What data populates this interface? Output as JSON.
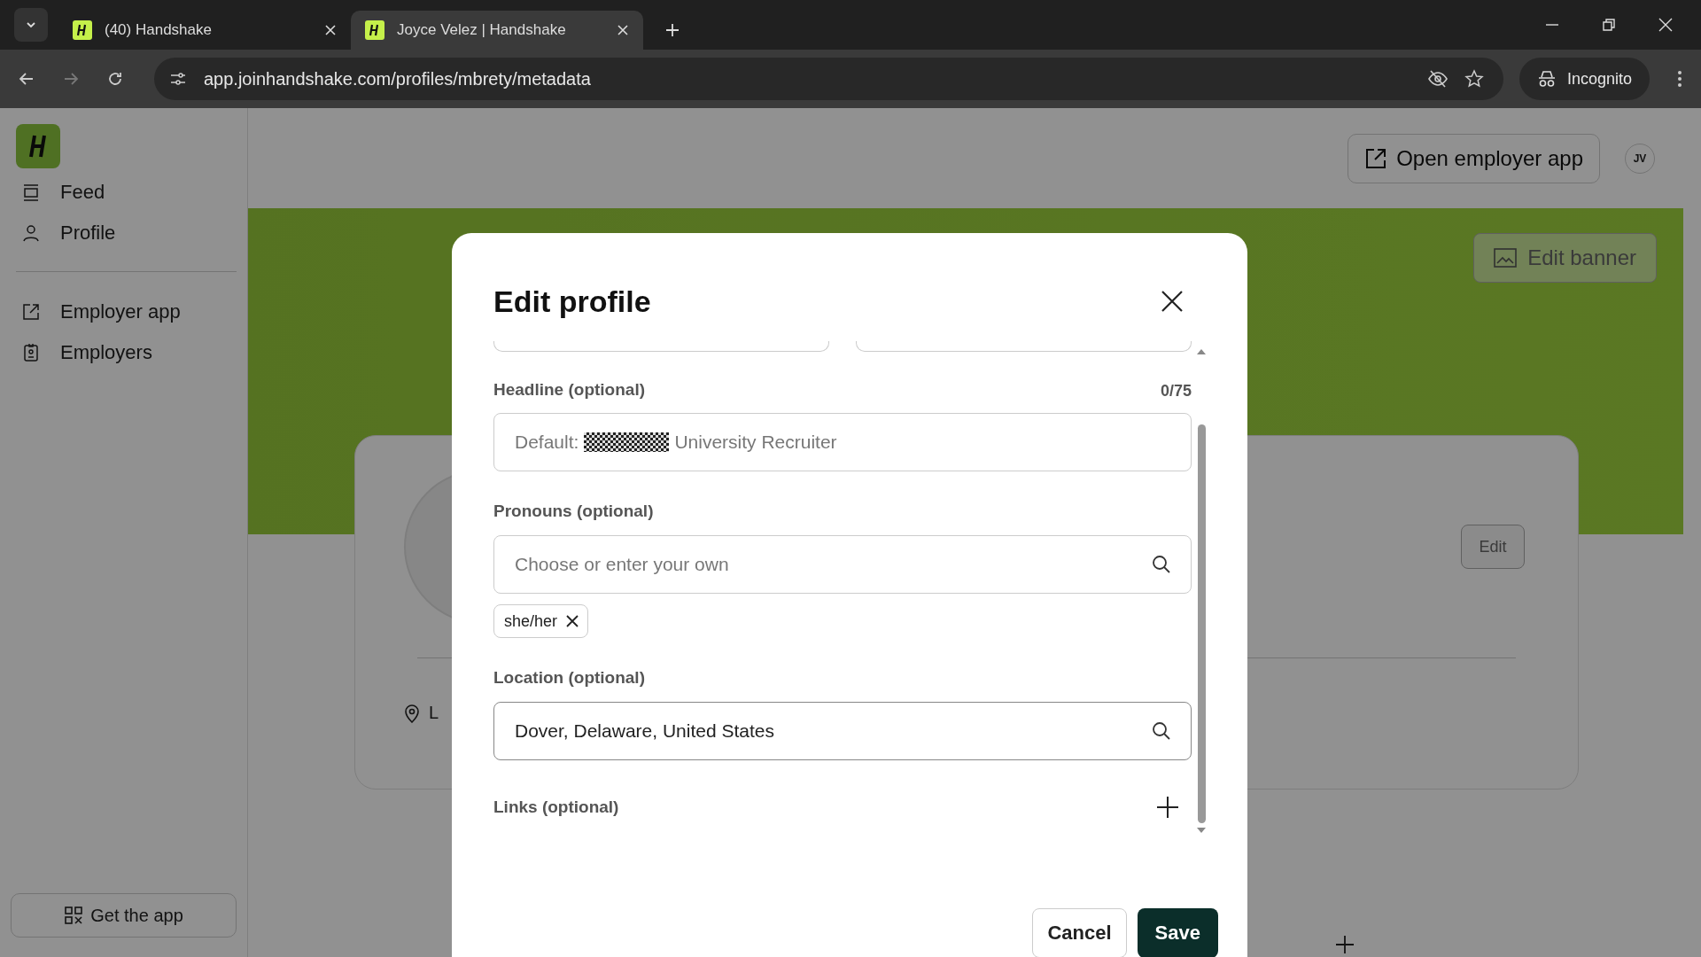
{
  "browser": {
    "tabs": [
      {
        "title": "(40) Handshake",
        "selected": false
      },
      {
        "title": "Joyce Velez | Handshake",
        "selected": true
      }
    ],
    "url": "app.joinhandshake.com/profiles/mbrety/metadata",
    "incognito_label": "Incognito"
  },
  "sidebar": {
    "primary_items": [
      {
        "label": "Feed"
      },
      {
        "label": "Profile"
      }
    ],
    "secondary_items": [
      {
        "label": "Employer app"
      },
      {
        "label": "Employers"
      }
    ],
    "get_app_button": "Get the app"
  },
  "header": {
    "open_employer_button": "Open employer app",
    "avatar_initials": "JV"
  },
  "banner": {
    "edit_banner_button": "Edit banner"
  },
  "profile_card": {
    "edit_button": "Edit",
    "location_text": "L"
  },
  "modal": {
    "title": "Edit profile",
    "headline": {
      "label": "Headline (optional)",
      "counter": "0/75",
      "placeholder_before_redaction": "Default:",
      "placeholder_after_redaction": "University Recruiter"
    },
    "pronouns": {
      "label": "Pronouns (optional)",
      "placeholder": "Choose or enter your own",
      "chips": [
        "she/her"
      ]
    },
    "location": {
      "label": "Location (optional)",
      "value": "Dover, Delaware, United States"
    },
    "links": {
      "label": "Links (optional)"
    },
    "buttons": {
      "cancel": "Cancel",
      "save": "Save"
    }
  }
}
